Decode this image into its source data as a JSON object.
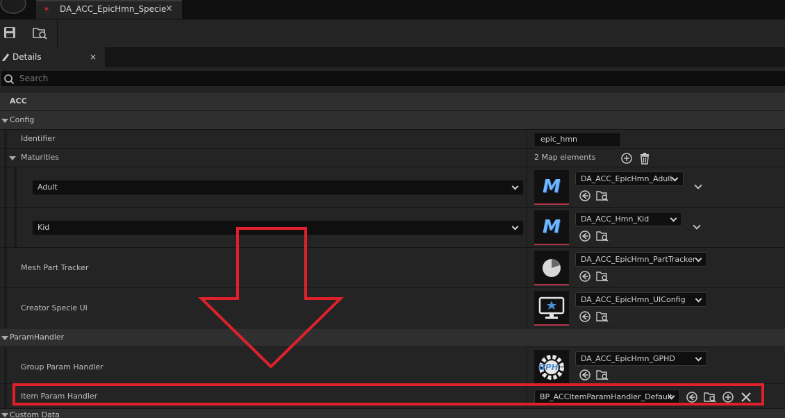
{
  "window": {
    "tab_title": "DA_ACC_EpicHmn_Specie",
    "tab_close": "×",
    "tab_icon": "asset-star-icon"
  },
  "toolbar": {
    "buttons": [
      "save-icon",
      "browse-icon"
    ]
  },
  "details_panel": {
    "tab_label": "Details",
    "tab_close": "×",
    "search_placeholder": "Search"
  },
  "categories": {
    "acc": "ACC",
    "config": "Config",
    "param_handler": "ParamHandler",
    "custom_data": "Custom Data"
  },
  "config": {
    "identifier_label": "Identifier",
    "identifier_value": "epic_hmn",
    "maturities_label": "Maturities",
    "maturities_count": "2 Map elements",
    "maturities": [
      {
        "key": "Adult",
        "asset": "DA_ACC_EpicHmn_Adult",
        "thumb": "M"
      },
      {
        "key": "Kid",
        "asset": "DA_ACC_Hmn_Kid",
        "thumb": "M"
      }
    ],
    "mesh_part_tracker_label": "Mesh Part Tracker",
    "mesh_part_tracker_value": "DA_ACC_EpicHmn_PartTracker",
    "creator_specie_ui_label": "Creator Specie UI",
    "creator_specie_ui_value": "DA_ACC_EpicHmn_UIConfig"
  },
  "param_handler": {
    "group_label": "Group Param Handler",
    "group_value": "DA_ACC_EpicHmn_GPHD",
    "group_thumb_text": "GPH",
    "item_label": "Item Param Handler",
    "item_value": "BP_ACCItemParamHandler_Default"
  },
  "colors": {
    "accent_red": "#e0212b",
    "thumb_border": "#b1364a",
    "panel_bg": "#242424",
    "field_bg": "#0f0f0f"
  }
}
